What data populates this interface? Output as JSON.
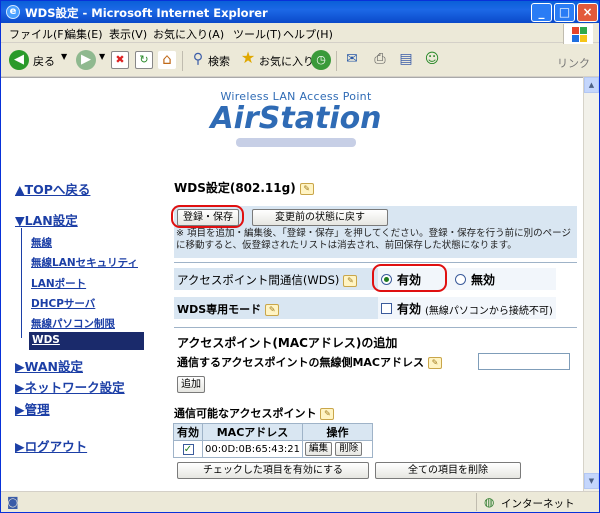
{
  "window": {
    "title": "WDS設定 - Microsoft Internet Explorer"
  },
  "menu": [
    "ファイル(F)",
    "編集(E)",
    "表示(V)",
    "お気に入り(A)",
    "ツール(T)",
    "ヘルプ(H)"
  ],
  "toolbar": {
    "back": "戻る",
    "search": "検索",
    "favorites": "お気に入り",
    "links": "リンク"
  },
  "logo": {
    "subtitle": "Wireless LAN Access Point",
    "name": "AirStation"
  },
  "nav": {
    "top": "▲TOPへ戻る",
    "lan": "▼LAN設定",
    "lan_items": [
      "無線",
      "無線LANセキュリティ",
      "LANポート",
      "DHCPサーバ",
      "無線パソコン制限"
    ],
    "lan_selected": "WDS",
    "wan": "▶WAN設定",
    "network": "▶ネットワーク設定",
    "admin": "▶管理",
    "logout": "▶ログアウト"
  },
  "main": {
    "heading": "WDS設定(802.11g)",
    "save_button": "登録・保存",
    "revert_button": "変更前の状態に戻す",
    "note": "※ 項目を追加・編集後、「登録・保存」を押してください。登録・保存を行う前に別のページに移動すると、仮登録されたリストは消去され、前回保存した状態になります。",
    "ap_comm_label": "アクセスポイント間通信(WDS)",
    "enable_label": "有効",
    "disable_label": "無効",
    "wds_mode_label": "WDS専用モード",
    "wds_mode_check_label": "有効",
    "wds_mode_note": "(無線パソコンから接続不可)",
    "add_heading": "アクセスポイント(MACアドレス)の追加",
    "mac_label": "通信するアクセスポイントの無線側MACアドレス",
    "mac_value": "",
    "add_button": "追加",
    "list_heading": "通信可能なアクセスポイント",
    "table": {
      "headers": [
        "有効",
        "MACアドレス",
        "操作"
      ],
      "rows": [
        {
          "mac": "00:0D:0B:65:43:21",
          "edit": "編集",
          "delete": "削除"
        }
      ]
    },
    "enable_checked_button": "チェックした項目を有効にする",
    "delete_all_button": "全ての項目を削除"
  },
  "status": {
    "zone": "インターネット"
  }
}
